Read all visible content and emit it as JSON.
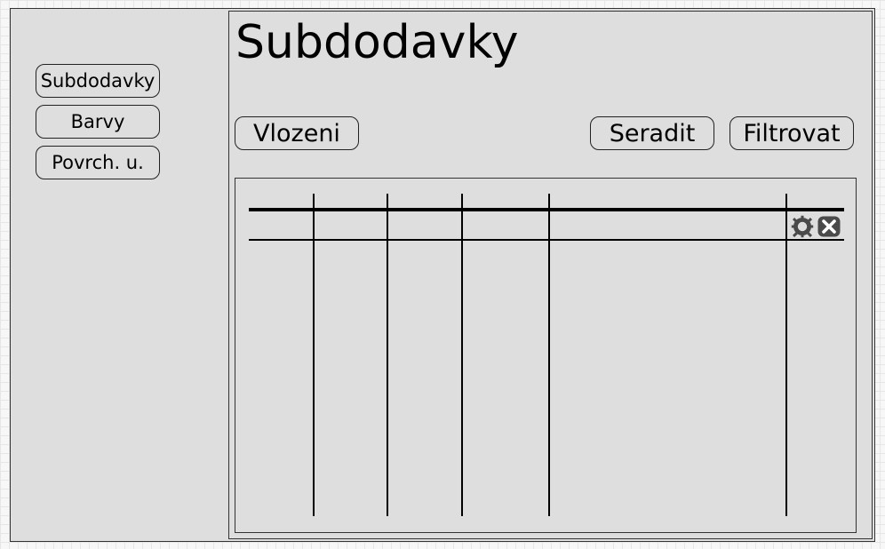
{
  "sidebar": {
    "items": [
      {
        "label": "Subdodavky"
      },
      {
        "label": "Barvy"
      },
      {
        "label": "Povrch. u."
      }
    ]
  },
  "page": {
    "title": "Subdodavky"
  },
  "actions": {
    "insert_label": "Vlozeni",
    "sort_label": "Seradit",
    "filter_label": "Filtrovat"
  },
  "table": {
    "row_icons": [
      "gear-icon",
      "close-icon"
    ]
  },
  "colors": {
    "panel_background": "#dedede",
    "stroke": "#000000",
    "icon_dark": "#4a4a4a"
  }
}
